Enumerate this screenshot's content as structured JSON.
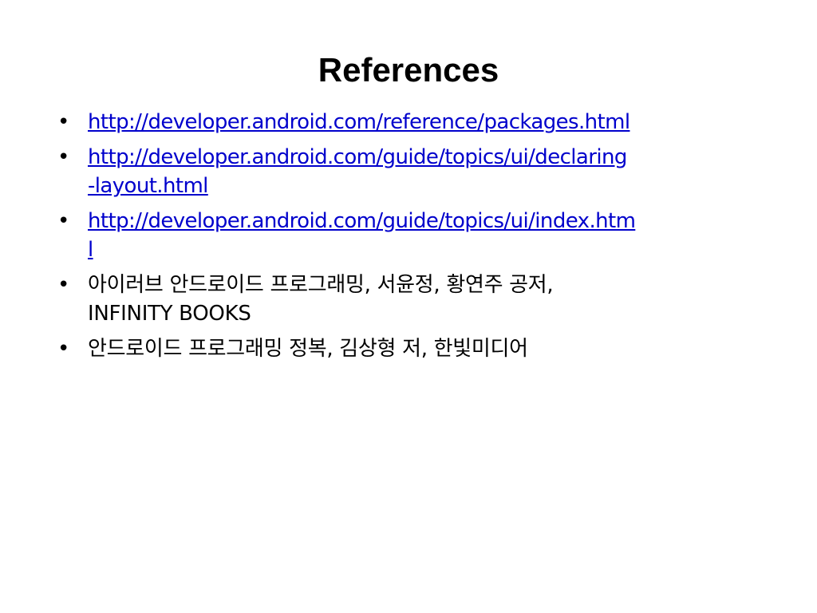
{
  "slide": {
    "title": "References",
    "bullet_char": "•",
    "items": [
      {
        "type": "link",
        "lines": [
          "http://developer.android.com/reference/packages.html"
        ]
      },
      {
        "type": "link",
        "lines": [
          "http://developer.android.com/guide/topics/ui/declaring",
          "-layout.html"
        ]
      },
      {
        "type": "link",
        "lines": [
          "http://developer.android.com/guide/topics/ui/index.htm",
          "l"
        ]
      },
      {
        "type": "text",
        "lines": [
          "아이러브 안드로이드 프로그래밍, 서윤정, 황연주 공저,",
          "INFINITY BOOKS"
        ]
      },
      {
        "type": "text",
        "lines": [
          "안드로이드 프로그래밍 정복, 김상형 저, 한빛미디어"
        ]
      }
    ]
  },
  "colors": {
    "link": "#0000cc",
    "text": "#000000",
    "background": "#ffffff"
  }
}
